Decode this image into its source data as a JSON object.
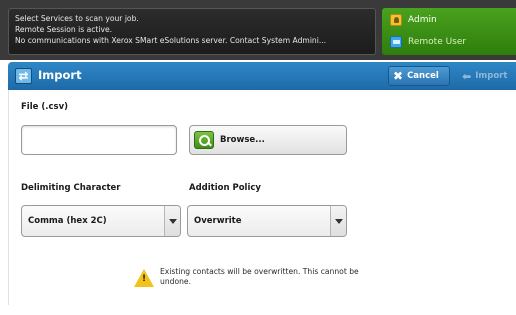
{
  "status": {
    "lines": [
      "Select Services to scan your job.",
      "Remote Session is active.",
      "No communications with Xerox SMart eSolutions server. Contact System Admini..."
    ]
  },
  "user_panel": {
    "admin_label": "Admin",
    "admin_icon": "admin-icon",
    "remote_label": "Remote User",
    "remote_icon": "remote-user-icon"
  },
  "titlebar": {
    "icon": "import-icon",
    "title": "Import",
    "cancel_label": "Cancel",
    "import_label": "Import"
  },
  "form": {
    "file_label": "File (.csv)",
    "file_value": "",
    "browse_label": "Browse...",
    "delimiting_label": "Delimiting Character",
    "delimiting_value": "Comma (hex 2C)",
    "addition_label": "Addition Policy",
    "addition_value": "Overwrite"
  },
  "warning": {
    "text": "Existing contacts will be overwritten. This cannot be undone."
  },
  "colors": {
    "title_blue": "#1e6aa8",
    "user_green": "#2e7d0c",
    "warning_yellow": "#f3c21a"
  }
}
